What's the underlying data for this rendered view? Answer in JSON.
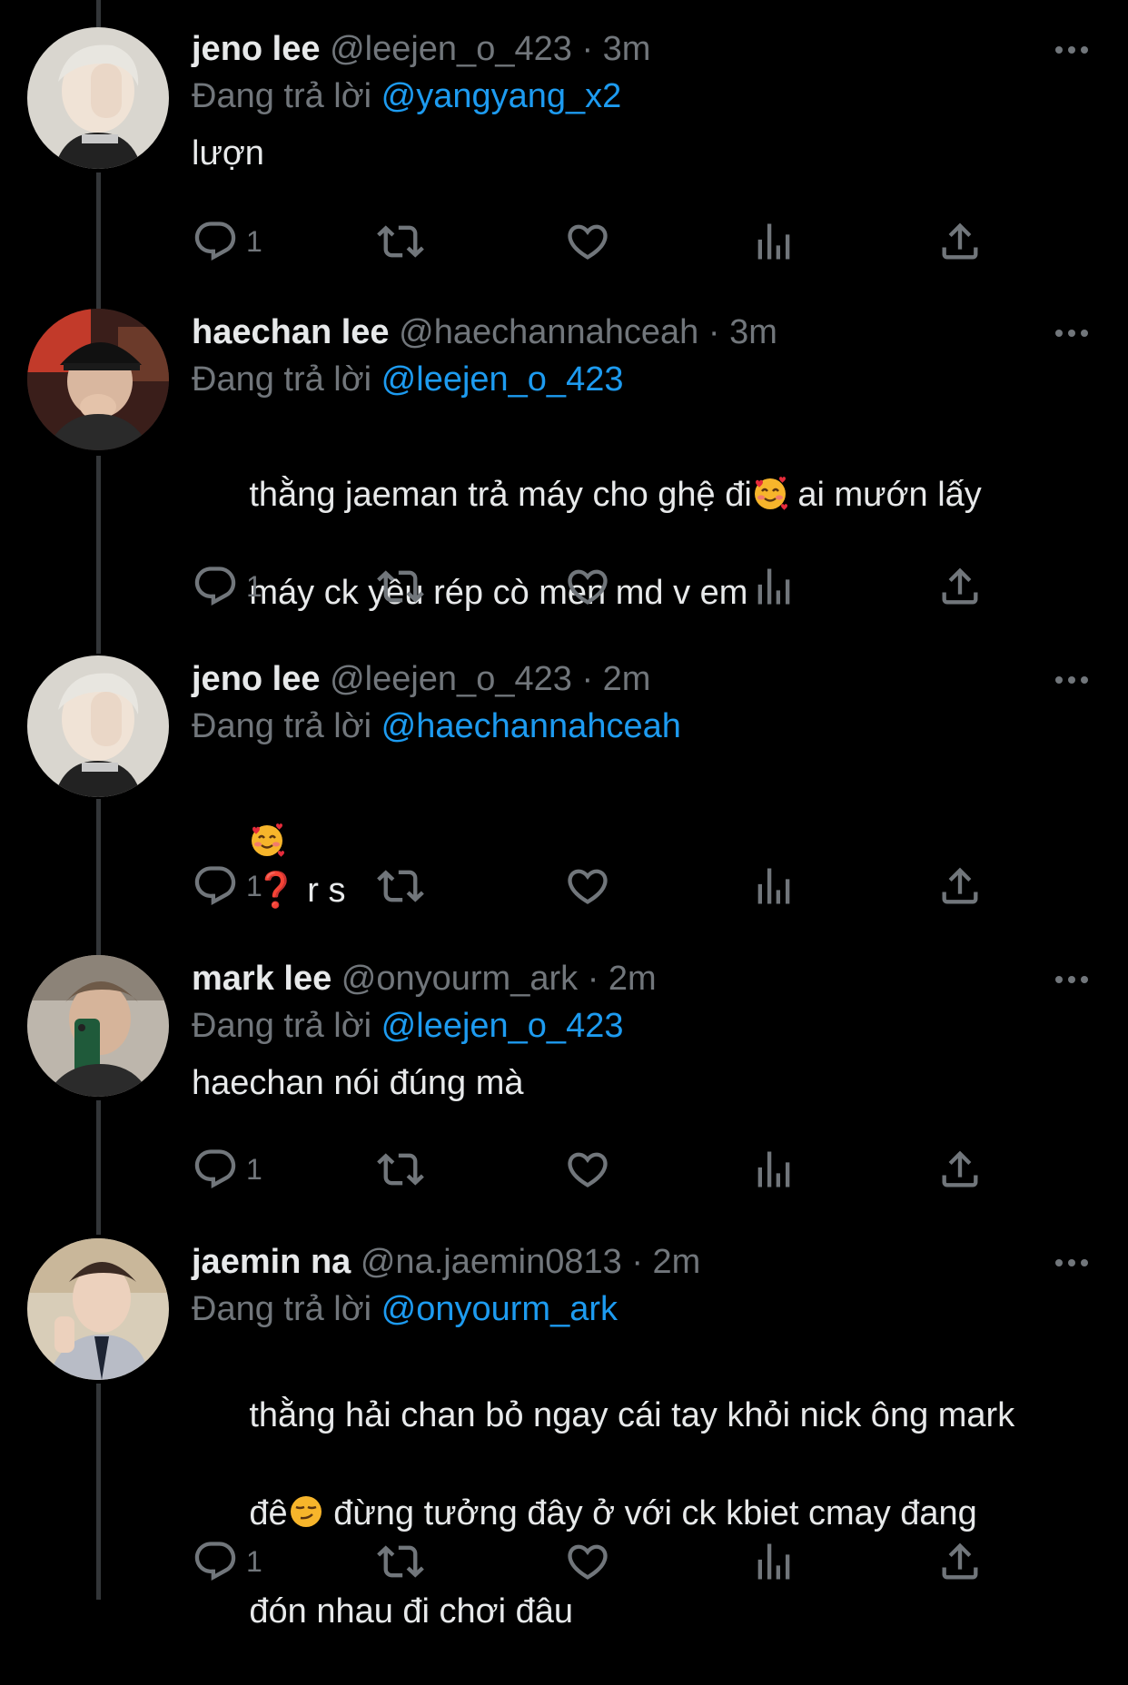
{
  "reply_prefix": "Đang trả lời",
  "tweets": [
    {
      "name": "jeno lee",
      "handle": "@leejen_o_423",
      "sep": "·",
      "time": "3m",
      "reply_to": "@yangyang_x2",
      "text": "lượn",
      "reply_count": "1"
    },
    {
      "name": "haechan lee",
      "handle": "@haechannahceah",
      "sep": "·",
      "time": "3m",
      "reply_to": "@leejen_o_423",
      "text_line1_a": "thằng jaeman trả máy cho ghệ đi",
      "text_line1_b": " ai mướn lấy",
      "text_line2": "máy ck yêu rép cò men md v em",
      "reply_count": "1"
    },
    {
      "name": "jeno lee",
      "handle": "@leejen_o_423",
      "sep": "·",
      "time": "2m",
      "reply_to": "@haechannahceah",
      "text_qmark": "❓",
      "text_tail": " r s",
      "reply_count": "1"
    },
    {
      "name": "mark lee",
      "handle": "@onyourm_ark",
      "sep": "·",
      "time": "2m",
      "reply_to": "@leejen_o_423",
      "text": "haechan nói đúng mà",
      "reply_count": "1"
    },
    {
      "name": "jaemin na",
      "handle": "@na.jaemin0813",
      "sep": "·",
      "time": "2m",
      "reply_to": "@onyourm_ark",
      "text_line1": "thằng hải chan bỏ ngay cái tay khỏi nick ông mark",
      "text_line2_a": "đê",
      "text_line2_b": " đừng tưởng đây ở với ck kbiet cmay đang",
      "text_line3": "đón nhau đi chơi đâu",
      "reply_count": "1"
    }
  ],
  "icons": {
    "reply": "reply-icon",
    "retweet": "retweet-icon",
    "like": "heart-icon",
    "views": "views-icon",
    "share": "share-icon",
    "more": "more-icon"
  },
  "colors": {
    "background": "#000000",
    "text": "#e7e9ea",
    "secondary": "#71767b",
    "accent": "#1d9bf0",
    "thread_line": "#333639"
  }
}
